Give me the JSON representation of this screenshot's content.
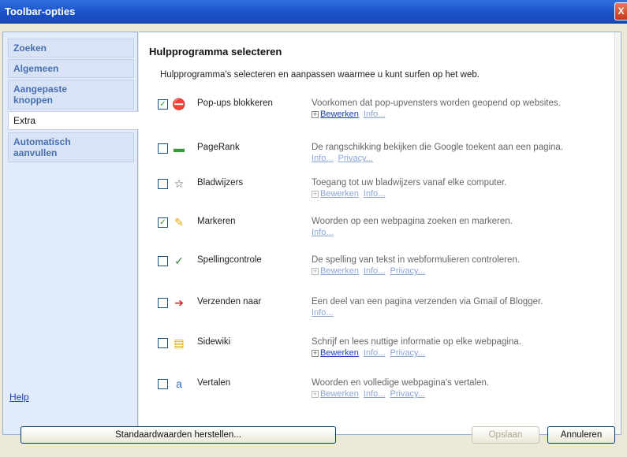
{
  "window": {
    "title": "Toolbar-opties",
    "close_label": "X"
  },
  "sidebar": {
    "tabs": [
      {
        "label": "Zoeken",
        "active": false
      },
      {
        "label": "Algemeen",
        "active": false
      },
      {
        "label": "Aangepaste\nknoppen",
        "active": false
      },
      {
        "label": "Extra",
        "active": true
      },
      {
        "label": "Automatisch\naanvullen",
        "active": false
      }
    ],
    "help": "Help"
  },
  "main": {
    "heading": "Hulpprogramma selecteren",
    "description": "Hulpprogramma's selecteren en aanpassen waarmee u kunt surfen op het web.",
    "tools": [
      {
        "name": "Pop-ups blokkeren",
        "checked": true,
        "icon": "popup-blocker-icon",
        "glyph": "⛔",
        "glyph_color": "#c0262c",
        "description": "Voorkomen dat pop-upvensters worden geopend op websites.",
        "links": [
          {
            "label": "Bewerken",
            "plus": true,
            "active": true
          },
          {
            "label": "Info...",
            "active": false
          }
        ]
      },
      {
        "name": "PageRank",
        "checked": false,
        "icon": "pagerank-icon",
        "glyph": "▬",
        "glyph_color": "#3a9a3a",
        "description": "De rangschikking bekijken die Google toekent aan een pagina.",
        "links": [
          {
            "label": "Info...",
            "active": false
          },
          {
            "label": "Privacy...",
            "active": false
          }
        ]
      },
      {
        "name": "Bladwijzers",
        "checked": false,
        "icon": "bookmark-star-icon",
        "glyph": "☆",
        "glyph_color": "#444",
        "description": "Toegang tot uw bladwijzers vanaf elke computer.",
        "links": [
          {
            "label": "Bewerken",
            "plus": true,
            "active": false
          },
          {
            "label": "Info...",
            "active": false
          }
        ]
      },
      {
        "name": "Markeren",
        "checked": true,
        "icon": "highlighter-icon",
        "glyph": "✎",
        "glyph_color": "#e0a800",
        "description": "Woorden op een webpagina zoeken en markeren.",
        "links": [
          {
            "label": "Info...",
            "active": false
          }
        ]
      },
      {
        "name": "Spellingcontrole",
        "checked": false,
        "icon": "spellcheck-icon",
        "glyph": "✓",
        "glyph_color": "#2a8a2a",
        "description": "De spelling van tekst in webformulieren controleren.",
        "links": [
          {
            "label": "Bewerken",
            "plus": true,
            "active": false
          },
          {
            "label": "Info...",
            "active": false
          },
          {
            "label": "Privacy...",
            "active": false
          }
        ]
      },
      {
        "name": "Verzenden naar",
        "checked": false,
        "icon": "send-arrow-icon",
        "glyph": "➔",
        "glyph_color": "#d0262c",
        "description": "Een deel van een pagina verzenden via Gmail of Blogger.",
        "links": [
          {
            "label": "Info...",
            "active": false
          }
        ]
      },
      {
        "name": "Sidewiki",
        "checked": false,
        "icon": "sidewiki-note-icon",
        "glyph": "▤",
        "glyph_color": "#e0a800",
        "description": "Schrijf en lees nuttige informatie op elke webpagina.",
        "links": [
          {
            "label": "Bewerken",
            "plus": true,
            "active": true
          },
          {
            "label": "Info...",
            "active": false
          },
          {
            "label": "Privacy...",
            "active": false
          }
        ]
      },
      {
        "name": "Vertalen",
        "checked": false,
        "icon": "translate-icon",
        "glyph": "a",
        "glyph_color": "#2a6ac0",
        "description": "Woorden en volledige webpagina's vertalen.",
        "links": [
          {
            "label": "Bewerken",
            "plus": true,
            "active": false
          },
          {
            "label": "Info...",
            "active": false
          },
          {
            "label": "Privacy...",
            "active": false
          }
        ]
      }
    ]
  },
  "footer": {
    "reset_label": "Standaardwaarden herstellen...",
    "save_label": "Opslaan",
    "cancel_label": "Annuleren"
  }
}
